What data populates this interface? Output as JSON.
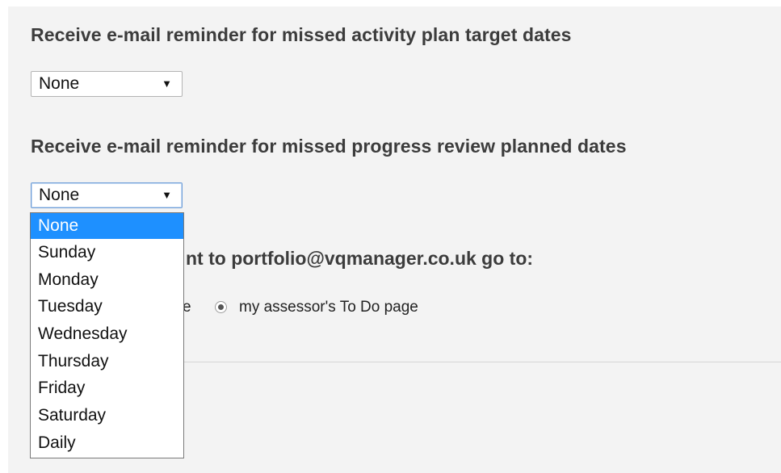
{
  "settings": {
    "activity_plan_heading": "Receive e-mail reminder for missed activity plan target dates",
    "activity_plan_value": "None",
    "progress_review_heading": "Receive e-mail reminder for missed progress review planned dates",
    "progress_review_value": "None",
    "email_routing_heading_visible": "nt to portfolio@vqmanager.co.uk go to:",
    "radio_option_1_visible": "e",
    "radio_option_2_label": "my assessor's To Do page",
    "radio_option_2_checked": true
  },
  "dropdown": {
    "selected_index": 0,
    "options": [
      "None",
      "Sunday",
      "Monday",
      "Tuesday",
      "Wednesday",
      "Thursday",
      "Friday",
      "Saturday",
      "Daily"
    ]
  },
  "icons": {
    "select_arrow": "triangle-down-icon"
  },
  "colors": {
    "background_panel": "#f3f3f3",
    "heading_text": "#3c3c3c",
    "highlight": "#1e90ff",
    "select_border": "#b4b4b4",
    "focus_border": "#6e9ed8"
  }
}
